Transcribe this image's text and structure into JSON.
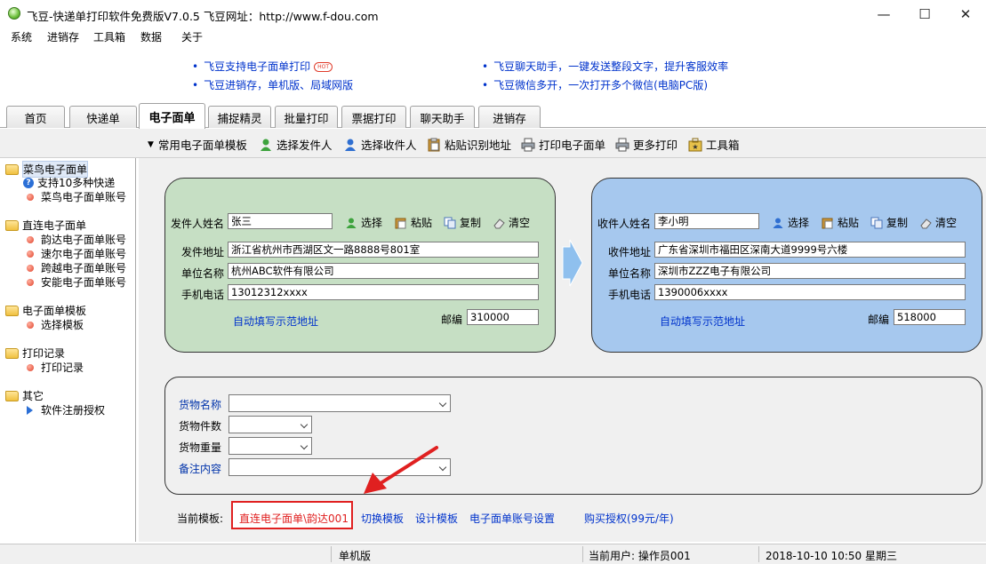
{
  "window": {
    "title": "飞豆-快递单打印软件免费版V7.0.5  飞豆网址：http://www.f-dou.com",
    "minimize": "—",
    "maximize": "☐",
    "close": "✕"
  },
  "menu": [
    "系统",
    "进销存",
    "工具箱",
    "数据",
    "关于"
  ],
  "promos": {
    "left": [
      "飞豆支持电子面单打印",
      "飞豆进销存，单机版、局域网版"
    ],
    "hot": "HOT",
    "right": [
      "飞豆聊天助手，一键发送整段文字，提升客服效率",
      "飞豆微信多开，一次打开多个微信(电脑PC版)"
    ]
  },
  "tabs": [
    "首页",
    "快递单",
    "电子面单",
    "捕捉精灵",
    "批量打印",
    "票据打印",
    "聊天助手",
    "进销存"
  ],
  "active_tab": "电子面单",
  "toolbar": {
    "template": "常用电子面单模板",
    "sender": "选择发件人",
    "receiver": "选择收件人",
    "paste_addr": "粘贴识别地址",
    "print": "打印电子面单",
    "more_print": "更多打印",
    "toolbox": "工具箱"
  },
  "sidebar": {
    "groups": [
      {
        "label": "菜鸟电子面单",
        "items": [
          "支持10多种快递",
          "菜鸟电子面单账号"
        ]
      },
      {
        "label": "直连电子面单",
        "items": [
          "韵达电子面单账号",
          "速尔电子面单账号",
          "跨越电子面单账号",
          "安能电子面单账号"
        ]
      },
      {
        "label": "电子面单模板",
        "items": [
          "选择模板"
        ]
      },
      {
        "label": "打印记录",
        "items": [
          "打印记录"
        ]
      },
      {
        "label": "其它",
        "items": [
          "软件注册授权"
        ]
      }
    ]
  },
  "sender": {
    "name_label": "发件人姓名",
    "name": "张三",
    "select": "选择",
    "paste": "粘贴",
    "copy": "复制",
    "clear": "清空",
    "addr_label": "发件地址",
    "addr": "浙江省杭州市西湖区文一路8888号801室",
    "company_label": "单位名称",
    "company": "杭州ABC软件有限公司",
    "phone_label": "手机电话",
    "phone": "13012312xxxx",
    "autofill": "自动填写示范地址",
    "zip_label": "邮编",
    "zip": "310000"
  },
  "receiver": {
    "name_label": "收件人姓名",
    "name": "李小明",
    "select": "选择",
    "paste": "粘贴",
    "copy": "复制",
    "clear": "清空",
    "addr_label": "收件地址",
    "addr": "广东省深圳市福田区深南大道9999号六楼",
    "company_label": "单位名称",
    "company": "深圳市ZZZ电子有限公司",
    "phone_label": "手机电话",
    "phone": "1390006xxxx",
    "autofill": "自动填写示范地址",
    "zip_label": "邮编",
    "zip": "518000"
  },
  "goods": {
    "name_label": "货物名称",
    "count_label": "货物件数",
    "weight_label": "货物重量",
    "note_label": "备注内容"
  },
  "footer": {
    "current_template_label": "当前模板:",
    "current_template": "直连电子面单\\韵达001",
    "switch": "切换模板",
    "design": "设计模板",
    "account_settings": "电子面单账号设置",
    "buy": "购买授权(99元/年)"
  },
  "status": {
    "mode": "单机版",
    "user": "当前用户: 操作员001",
    "datetime": "2018-10-10 10:50 星期三"
  },
  "colors": {
    "sender_card": "#c6dfc4",
    "receiver_card": "#a6c8ee",
    "arrow": "#8fc0ee",
    "highlight": "#e02020"
  }
}
